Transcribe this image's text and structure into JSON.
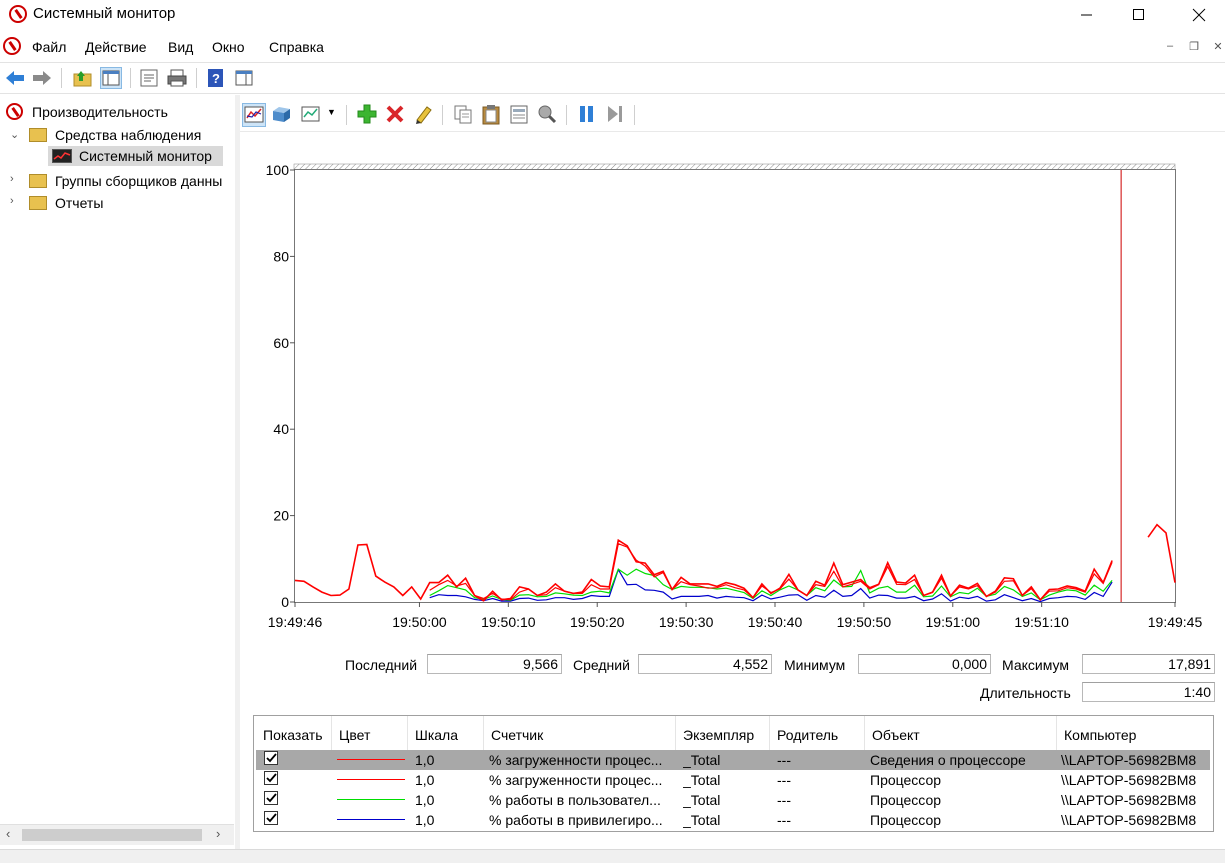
{
  "window": {
    "title": "Системный монитор"
  },
  "menu": [
    "Файл",
    "Действие",
    "Вид",
    "Окно",
    "Справка"
  ],
  "tree": {
    "root": "Производительность",
    "monitoring_tools": "Средства наблюдения",
    "system_monitor": "Системный монитор",
    "collector_groups": "Группы сборщиков данны",
    "reports": "Отчеты"
  },
  "chart_data": {
    "type": "line",
    "ylim": [
      0,
      100
    ],
    "yticks": [
      "100",
      "80",
      "60",
      "40",
      "20",
      "0"
    ],
    "xticks": [
      "19:49:46",
      "19:50:00",
      "19:50:10",
      "19:50:20",
      "19:50:30",
      "19:50:40",
      "19:50:50",
      "19:51:00",
      "19:51:10",
      "19:49:45"
    ],
    "series": [
      {
        "color": "#ff0000",
        "values": [
          5,
          4.8,
          3.5,
          2.3,
          1.5,
          1.6,
          3,
          13.2,
          13.3,
          6,
          4.6,
          3.5,
          1.5,
          3.5,
          0.7,
          4.5,
          4.5,
          6.2,
          3.5,
          5.5,
          1.5,
          0.3,
          2.5,
          0.5,
          0.8,
          3.5,
          3,
          1.5,
          2.3,
          4.2,
          2.5,
          2,
          2.3,
          5.2,
          3.7,
          3.5,
          14.3,
          13,
          9.3,
          9,
          6.3,
          7.1,
          2.9,
          5.7,
          4.2,
          4.2,
          4.2,
          3.6,
          4.5,
          4,
          3.2,
          1,
          4.2,
          2,
          3.2,
          6.4,
          2.8,
          1.5,
          4.8,
          3.9,
          9,
          4,
          4.6,
          5.2,
          3.3,
          4.1,
          9.1,
          4.6,
          4.4,
          6.2,
          1.5,
          2.3,
          6.2,
          1.4,
          3.9,
          3.2,
          4.3,
          1.3,
          2.5,
          5.6,
          5.4,
          1.5,
          3.5,
          0.5,
          2.9,
          3,
          3.7,
          3.3,
          2.5,
          7.6,
          4.5,
          9.6,
          null,
          null,
          null,
          15,
          17.9,
          16,
          4.5
        ]
      },
      {
        "color": "#ff0000",
        "values": [
          null,
          null,
          null,
          null,
          null,
          null,
          null,
          null,
          null,
          null,
          null,
          null,
          null,
          null,
          null,
          2.7,
          4,
          5,
          3.7,
          4.3,
          1.5,
          0.8,
          2,
          0.7,
          0.5,
          2.3,
          3,
          1.5,
          1.7,
          3.3,
          2.5,
          2,
          2,
          4,
          3,
          3,
          13.5,
          12.7,
          9.7,
          8.3,
          5.8,
          6.8,
          2.9,
          4.7,
          4,
          3.7,
          3.2,
          3.3,
          4,
          3.3,
          2.8,
          1,
          3.7,
          2.2,
          3,
          5.3,
          2.8,
          1.5,
          4,
          3.6,
          7.1,
          3.5,
          4.1,
          4.8,
          3,
          4,
          8.2,
          4.1,
          4,
          5.2,
          1.5,
          2.2,
          5.5,
          1.4,
          3.5,
          3,
          3.8,
          1.3,
          2.3,
          4.8,
          4.9,
          1.5,
          3.1,
          0.5,
          2.5,
          2.6,
          3.3,
          3,
          2.3,
          6.5,
          4.3,
          9.2
        ]
      },
      {
        "color": "#00dd00",
        "values": [
          null,
          null,
          null,
          null,
          null,
          null,
          null,
          null,
          null,
          null,
          null,
          null,
          null,
          null,
          null,
          1.5,
          2.6,
          3.8,
          3.3,
          2.8,
          1,
          0.6,
          1.4,
          0.6,
          0.4,
          1.6,
          1.7,
          1.2,
          1.3,
          2.1,
          1.9,
          1.6,
          1.5,
          2.3,
          2.5,
          2.1,
          7.6,
          6.2,
          7.6,
          6.6,
          6.1,
          4,
          2.9,
          3.6,
          3.4,
          3.4,
          3.3,
          3,
          3.2,
          2.7,
          2.2,
          0.8,
          2.6,
          1.5,
          2.8,
          3.7,
          2.8,
          1.5,
          3.3,
          2.6,
          5.1,
          3.5,
          3.6,
          7.3,
          2.1,
          3.2,
          3.6,
          2.3,
          2.3,
          3.9,
          1.2,
          1.4,
          3.7,
          1.2,
          2.2,
          1.9,
          3.2,
          1.3,
          1.8,
          3.6,
          2.8,
          1.3,
          2.1,
          0.5,
          1.6,
          2.3,
          2.8,
          2.6,
          1.6,
          3.9,
          2.5,
          5
        ]
      },
      {
        "color": "#0000cc",
        "values": [
          null,
          null,
          null,
          null,
          null,
          null,
          null,
          null,
          null,
          null,
          null,
          null,
          null,
          null,
          null,
          1,
          1.7,
          1.5,
          1.5,
          1.2,
          0.6,
          0.3,
          0.8,
          0.2,
          0.2,
          0.8,
          0.9,
          0.4,
          0.5,
          1,
          1,
          0.6,
          0.8,
          1.5,
          1.3,
          1.3,
          7.5,
          4,
          4.1,
          2.8,
          2.7,
          2.3,
          0.7,
          1.3,
          1.3,
          1.3,
          1.5,
          0.9,
          1.3,
          1.1,
          1,
          0.3,
          1.6,
          0.7,
          1.1,
          1.6,
          1.7,
          0.4,
          1.5,
          1.1,
          2.7,
          1.3,
          1.5,
          3.1,
          0.9,
          1.6,
          1.5,
          0.9,
          0.9,
          1.3,
          0.3,
          0.7,
          1.9,
          0.2,
          1.1,
          0.8,
          1.3,
          0.2,
          0.5,
          1.7,
          1,
          0.3,
          0.8,
          0.1,
          0.8,
          1,
          1.3,
          1.2,
          0.6,
          2.2,
          1.3,
          4.6
        ]
      }
    ],
    "cursor_index": 92
  },
  "stats": {
    "last_label": "Последний",
    "last_value": "9,566",
    "avg_label": "Средний",
    "avg_value": "4,552",
    "min_label": "Минимум",
    "min_value": "0,000",
    "max_label": "Максимум",
    "max_value": "17,891",
    "duration_label": "Длительность",
    "duration_value": "1:40"
  },
  "legend": {
    "headers": [
      "Показать",
      "Цвет",
      "Шкала",
      "Счетчик",
      "Экземпляр",
      "Родитель",
      "Объект",
      "Компьютер"
    ],
    "rows": [
      {
        "color": "#ff0000",
        "scale": "1,0",
        "counter": "% загруженности процес...",
        "instance": "_Total",
        "parent": "---",
        "object": "Сведения о процессоре",
        "computer": "\\\\LAPTOP-56982BM8"
      },
      {
        "color": "#ff0000",
        "scale": "1,0",
        "counter": "% загруженности процес...",
        "instance": "_Total",
        "parent": "---",
        "object": "Процессор",
        "computer": "\\\\LAPTOP-56982BM8"
      },
      {
        "color": "#00dd00",
        "scale": "1,0",
        "counter": "% работы в пользовател...",
        "instance": "_Total",
        "parent": "---",
        "object": "Процессор",
        "computer": "\\\\LAPTOP-56982BM8"
      },
      {
        "color": "#0000cc",
        "scale": "1,0",
        "counter": "% работы в привилегиро...",
        "instance": "_Total",
        "parent": "---",
        "object": "Процессор",
        "computer": "\\\\LAPTOP-56982BM8"
      }
    ]
  }
}
